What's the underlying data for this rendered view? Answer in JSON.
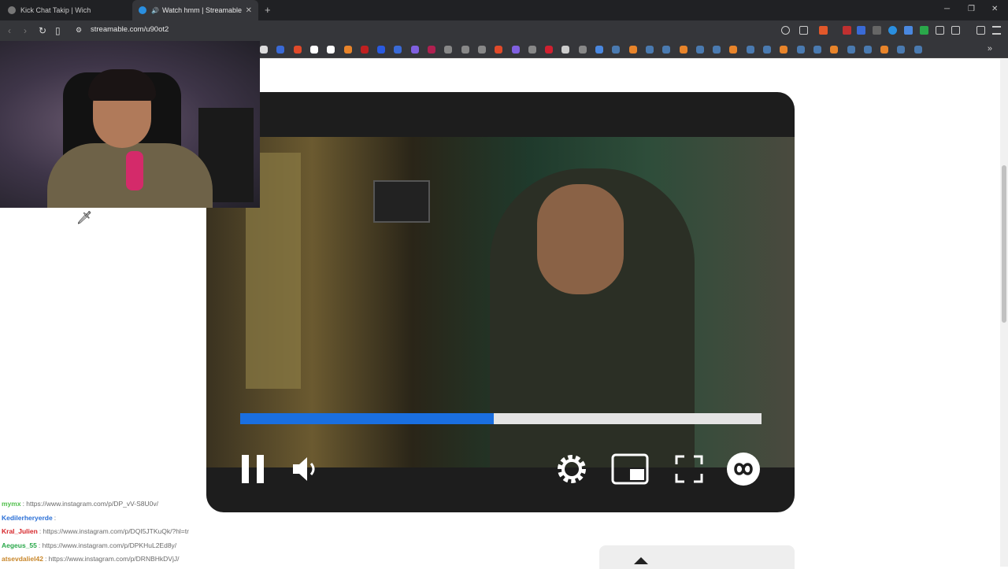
{
  "browser": {
    "tabs": [
      {
        "title": "Kick Chat Takip | Wich",
        "active": false
      },
      {
        "title": "Watch hmm | Streamable",
        "active": true
      }
    ],
    "url": "streamable.com/u90ot2"
  },
  "player": {
    "progress_fraction": 0.486,
    "progress_color": "#1a6fe0",
    "controls": [
      "pause-icon",
      "volume-icon",
      "settings-icon",
      "picture-in-picture-icon",
      "fullscreen-icon",
      "streamable-logo-icon"
    ]
  },
  "chat": {
    "lines": [
      {
        "user": "mymx",
        "msg": ": https://www.instagram.com/p/DP_vV-S8U0v/",
        "color": "#4fbf4a"
      },
      {
        "user": "Kedilerheryerde",
        "msg": ":",
        "color": "#2a6fd6"
      },
      {
        "user": "Kral_Julien",
        "msg": ": https://www.instagram.com/p/DQI5JTKuQk/?hl=tr",
        "color": "#d6262a"
      },
      {
        "user": "Aegeus_55",
        "msg": ": https://www.instagram.com/p/DPKHuL2Ed8y/",
        "color": "#2aa84a"
      },
      {
        "user": "atsevdaliel42",
        "msg": ": https://www.instagram.com/p/DRNBHkDVjJ/",
        "color": "#c8862a"
      }
    ]
  }
}
